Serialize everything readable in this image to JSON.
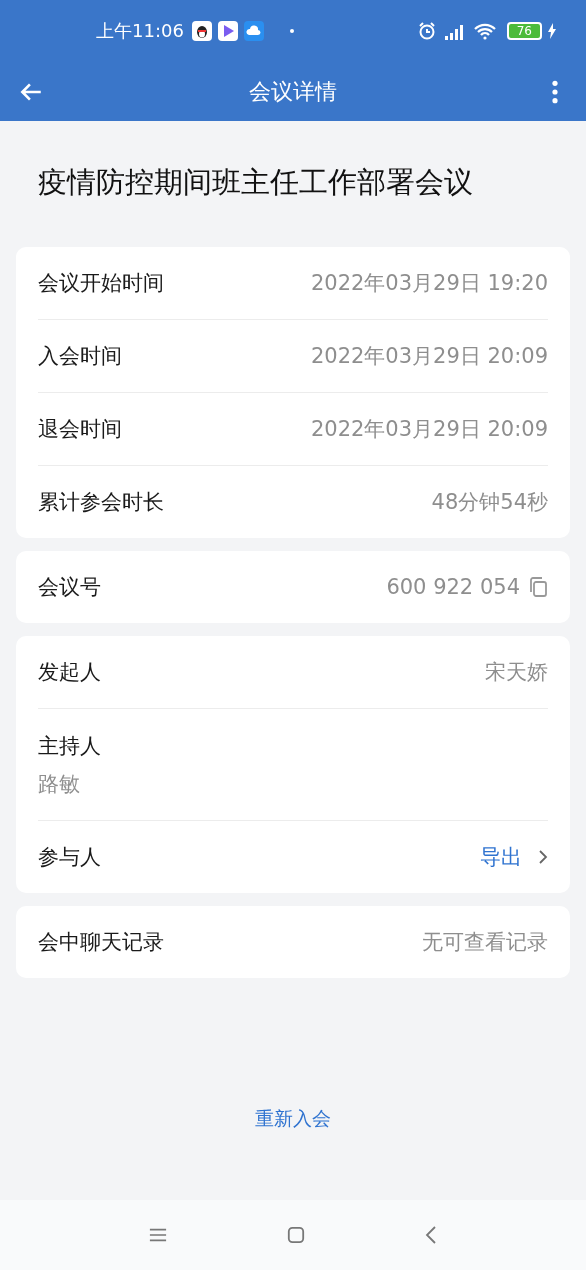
{
  "status_bar": {
    "time": "上午11:06",
    "battery": "76"
  },
  "toolbar": {
    "title": "会议详情"
  },
  "meeting_title": "疫情防控期间班主任工作部署会议",
  "groups": [
    {
      "rows": [
        {
          "kind": "inline",
          "label": "会议开始时间",
          "value": "2022年03月29日 19:20"
        },
        {
          "kind": "inline",
          "label": "入会时间",
          "value": "2022年03月29日 20:09"
        },
        {
          "kind": "inline",
          "label": "退会时间",
          "value": "2022年03月29日 20:09"
        },
        {
          "kind": "inline",
          "label": "累计参会时长",
          "value": "48分钟54秒"
        }
      ]
    },
    {
      "rows": [
        {
          "kind": "copy",
          "label": "会议号",
          "value": "600 922 054"
        }
      ]
    },
    {
      "rows": [
        {
          "kind": "inline",
          "label": "发起人",
          "value": "宋天娇"
        },
        {
          "kind": "stacked",
          "label": "主持人",
          "value": "路敏"
        },
        {
          "kind": "link",
          "label": "参与人",
          "value": "导出"
        }
      ]
    },
    {
      "rows": [
        {
          "kind": "inline",
          "label": "会中聊天记录",
          "value": "无可查看记录"
        }
      ]
    }
  ],
  "rejoin_link": "重新入会"
}
